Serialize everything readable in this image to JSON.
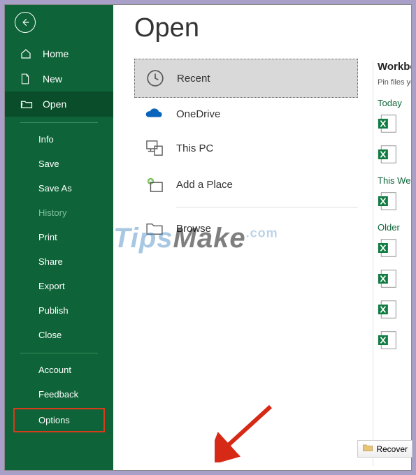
{
  "sidebar": {
    "home": "Home",
    "new": "New",
    "open": "Open",
    "info": "Info",
    "save": "Save",
    "saveas": "Save As",
    "history": "History",
    "print": "Print",
    "share": "Share",
    "export": "Export",
    "publish": "Publish",
    "close": "Close",
    "account": "Account",
    "feedback": "Feedback",
    "options": "Options"
  },
  "main": {
    "title": "Open",
    "locations": {
      "recent": "Recent",
      "onedrive": "OneDrive",
      "thispc": "This PC",
      "addplace": "Add a Place",
      "browse": "Browse"
    }
  },
  "right": {
    "heading": "Workbooks",
    "hint": "Pin files you…",
    "today": "Today",
    "thisweek": "This Week",
    "older": "Older",
    "recover": "Recover"
  },
  "watermark": {
    "t1": "Tips",
    "t2": "Make",
    "t3": ".com"
  }
}
